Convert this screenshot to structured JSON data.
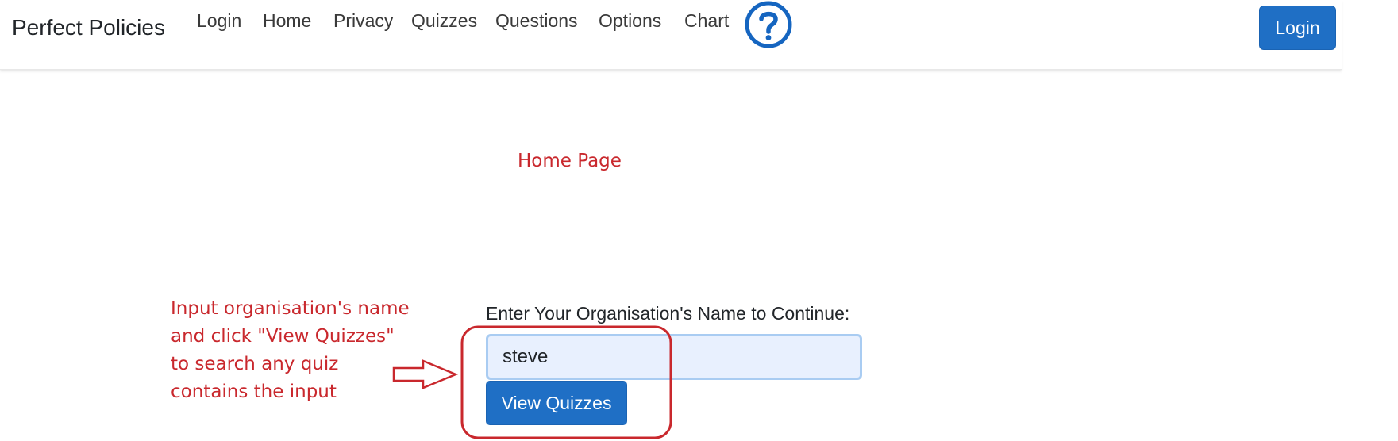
{
  "navbar": {
    "brand": "Perfect Policies",
    "links": [
      "Login",
      "Home",
      "Privacy",
      "Quizzes",
      "Questions",
      "Options",
      "Chart"
    ],
    "help_icon": "question-circle-icon",
    "login_button": "Login"
  },
  "annotations": {
    "home_page": "Home Page",
    "instruction_lines": [
      "Input organisation's name",
      "and click \"View Quizzes\"",
      "to search any quiz",
      "contains the input"
    ],
    "arrow_icon": "right-arrow-icon"
  },
  "form": {
    "label": "Enter Your Organisation's Name to Continue:",
    "input_value": "steve",
    "button_label": "View Quizzes"
  },
  "colors": {
    "primary": "#1f6fc5",
    "annotation": "#c9282d",
    "help_icon": "#1565c0"
  }
}
